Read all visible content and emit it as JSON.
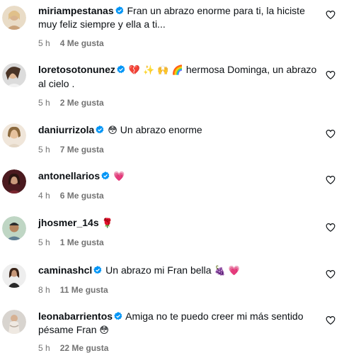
{
  "comments": [
    {
      "username": "miriampestanas",
      "verified": true,
      "text": "Fran un abrazo enorme para ti, la hiciste muy feliz siempre y ella a ti...",
      "emojis": "",
      "time": "5 h",
      "likes": "4 Me gusta"
    },
    {
      "username": "loretosotonunez",
      "verified": true,
      "emojis": "💔 ✨ 🙌 🌈",
      "text": "hermosa Dominga, un abrazo al cielo .",
      "time": "5 h",
      "likes": "2 Me gusta"
    },
    {
      "username": "daniurrizola",
      "verified": true,
      "emojis": "😳",
      "text": "Un abrazo enorme",
      "time": "5 h",
      "likes": "7 Me gusta"
    },
    {
      "username": "antonellarios",
      "verified": true,
      "emojis": "💗",
      "text": "",
      "time": "4 h",
      "likes": "6 Me gusta"
    },
    {
      "username": "jhosmer_14s",
      "verified": false,
      "emojis": "🌹",
      "text": "",
      "time": "5 h",
      "likes": "1 Me gusta"
    },
    {
      "username": "caminashcl",
      "verified": true,
      "text": "Un abrazo mi Fran bella",
      "emojis_after": "🍇 💗",
      "time": "8 h",
      "likes": "11 Me gusta"
    },
    {
      "username": "leonabarrientos",
      "verified": true,
      "text": "Amiga no te puedo creer mi más sentido pésame Fran",
      "emojis_after": "😳",
      "time": "5 h",
      "likes": "22 Me gusta"
    }
  ],
  "colors": {
    "text": "#0c1014",
    "meta": "#737373",
    "verified": "#0095f6",
    "story_ring_start": "#feda75",
    "story_ring_end": "#d62976"
  },
  "icons": {
    "verified": "verified-badge-icon",
    "like": "heart-outline-icon"
  }
}
